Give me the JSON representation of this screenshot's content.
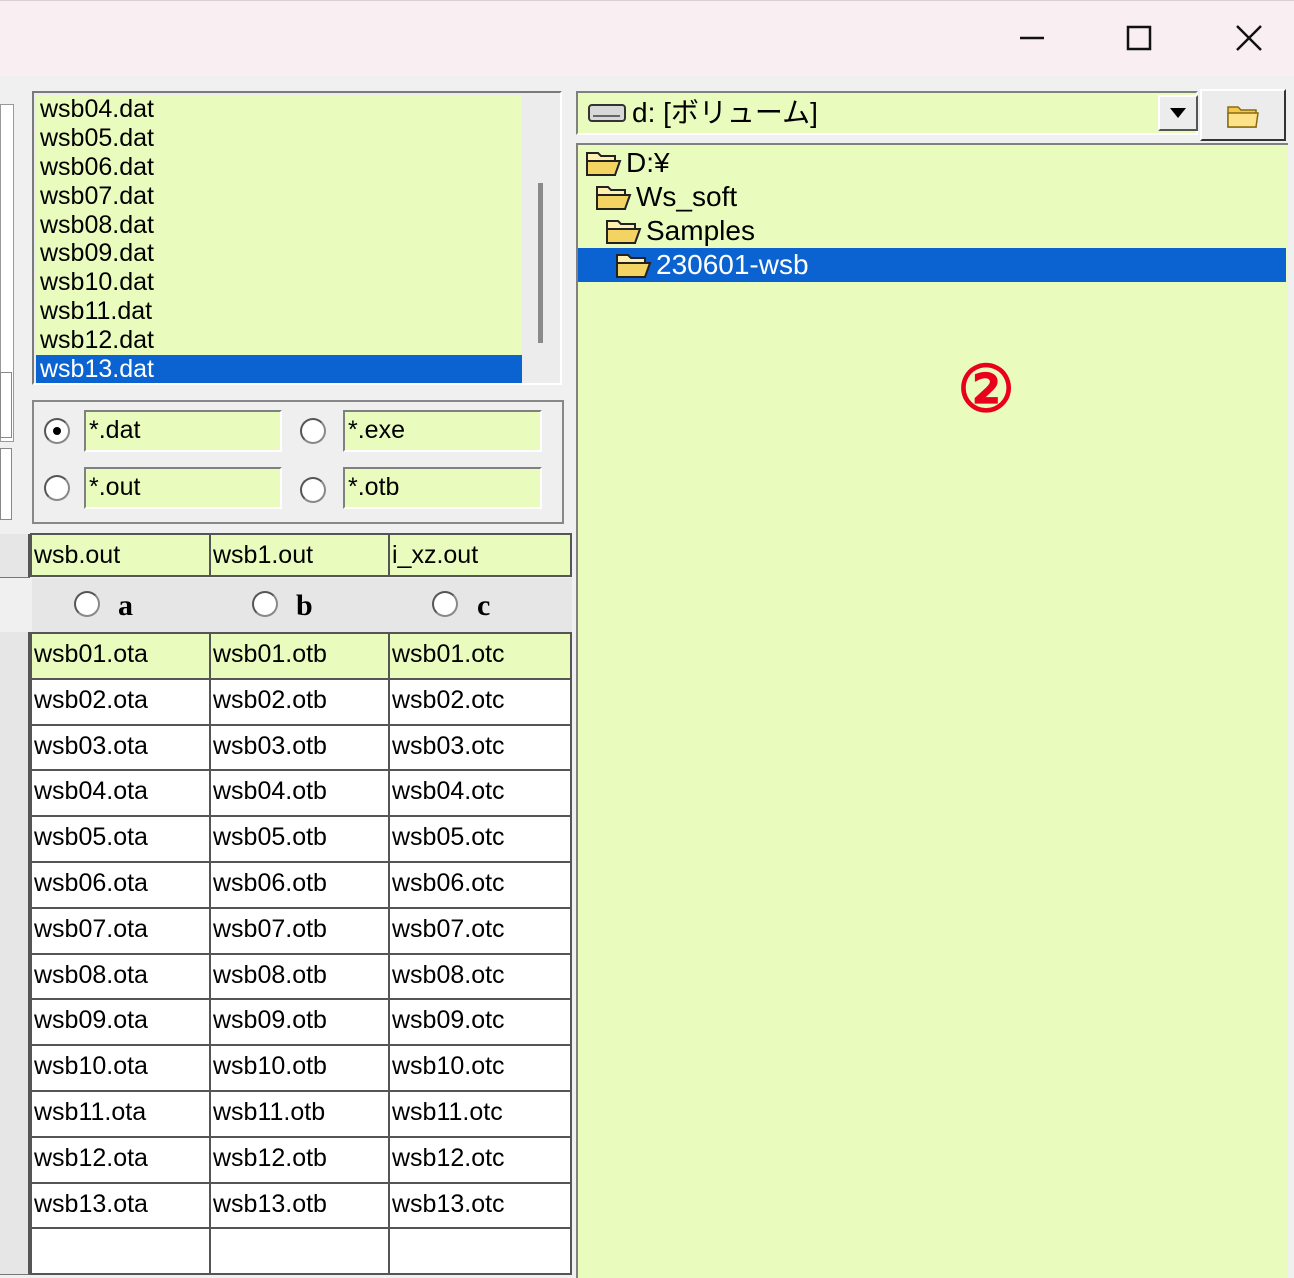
{
  "window": {
    "buttons": {
      "minimize": "minimize",
      "maximize": "maximize",
      "close": "close"
    }
  },
  "file_list": {
    "items": [
      "wsb04.dat",
      "wsb05.dat",
      "wsb06.dat",
      "wsb07.dat",
      "wsb08.dat",
      "wsb09.dat",
      "wsb10.dat",
      "wsb11.dat",
      "wsb12.dat",
      "wsb13.dat"
    ],
    "selected": "wsb13.dat"
  },
  "filters": {
    "dat": "*.dat",
    "exe": "*.exe",
    "out": "*.out",
    "otb": "*.otb",
    "selected": "*.dat"
  },
  "output_files": [
    "wsb.out",
    "wsb1.out",
    "i_xz.out"
  ],
  "columns": [
    "a",
    "b",
    "c"
  ],
  "table_rows": [
    [
      "wsb01.ota",
      "wsb01.otb",
      "wsb01.otc"
    ],
    [
      "wsb02.ota",
      "wsb02.otb",
      "wsb02.otc"
    ],
    [
      "wsb03.ota",
      "wsb03.otb",
      "wsb03.otc"
    ],
    [
      "wsb04.ota",
      "wsb04.otb",
      "wsb04.otc"
    ],
    [
      "wsb05.ota",
      "wsb05.otb",
      "wsb05.otc"
    ],
    [
      "wsb06.ota",
      "wsb06.otb",
      "wsb06.otc"
    ],
    [
      "wsb07.ota",
      "wsb07.otb",
      "wsb07.otc"
    ],
    [
      "wsb08.ota",
      "wsb08.otb",
      "wsb08.otc"
    ],
    [
      "wsb09.ota",
      "wsb09.otb",
      "wsb09.otc"
    ],
    [
      "wsb10.ota",
      "wsb10.otb",
      "wsb10.otc"
    ],
    [
      "wsb11.ota",
      "wsb11.otb",
      "wsb11.otc"
    ],
    [
      "wsb12.ota",
      "wsb12.otb",
      "wsb12.otc"
    ],
    [
      "wsb13.ota",
      "wsb13.otb",
      "wsb13.otc"
    ],
    [
      "",
      "",
      ""
    ]
  ],
  "drive": {
    "label": "d: [ボリューム]"
  },
  "directories": [
    {
      "name": "D:¥",
      "level": 0
    },
    {
      "name": "Ws_soft",
      "level": 1
    },
    {
      "name": "Samples",
      "level": 2
    },
    {
      "name": "230601-wsb",
      "level": 3,
      "selected": true
    }
  ],
  "annotation": "②",
  "colors": {
    "field_bg": "#e9fbbd",
    "selection": "#0a63d1",
    "annotation": "#e8001c"
  },
  "icons": [
    "drive-icon",
    "folder-open-icon",
    "folder-browse-icon",
    "chevron-down-icon"
  ]
}
